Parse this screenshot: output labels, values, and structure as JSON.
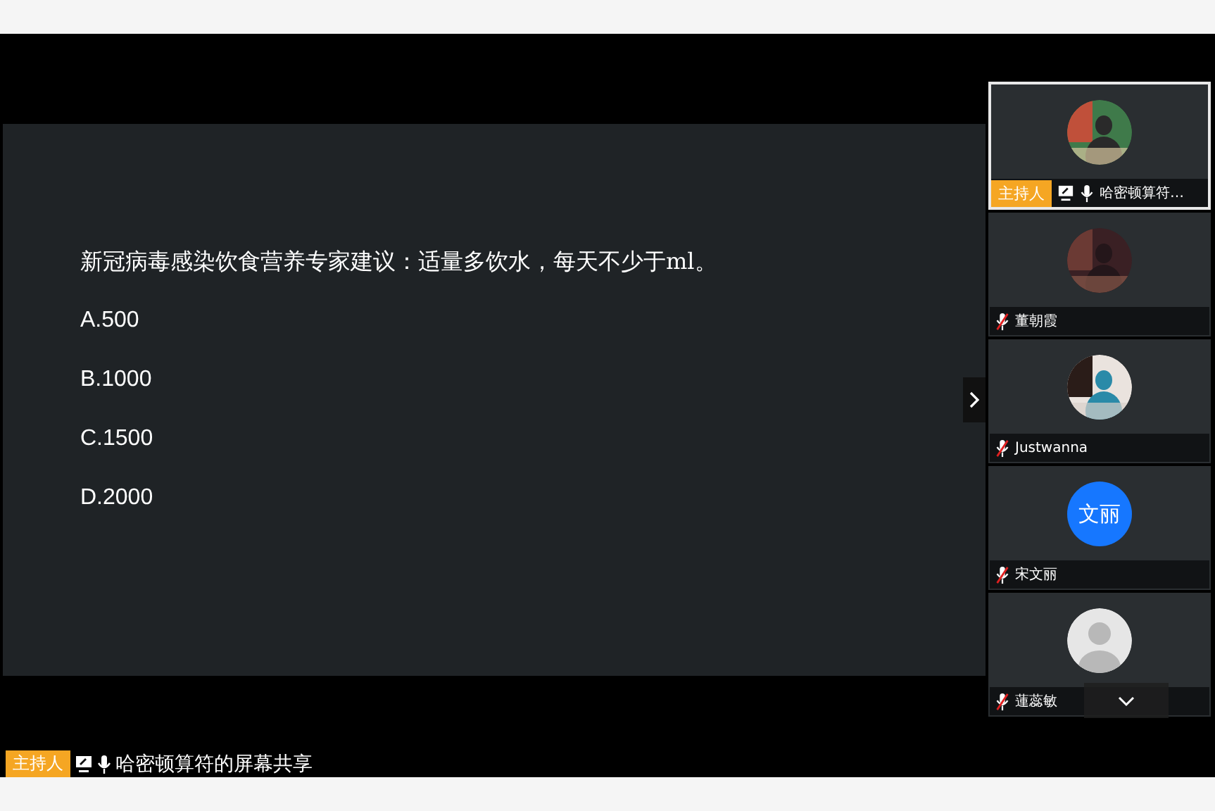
{
  "slide": {
    "question": "新冠病毒感染饮食营养专家建议：适量多饮水，每天不少于ml。",
    "options": [
      "A.500",
      "B.1000",
      "C.1500",
      "D.2000"
    ]
  },
  "participants": [
    {
      "name": "哈密顿算符…",
      "host_badge": "主持人",
      "sharing": true,
      "muted": false,
      "selected": true
    },
    {
      "name": "董朝霞",
      "sharing": false,
      "muted": true,
      "selected": false
    },
    {
      "name": "Justwanna",
      "sharing": false,
      "muted": true,
      "selected": false
    },
    {
      "name": "宋文丽",
      "sharing": false,
      "muted": true,
      "selected": false,
      "avatar": {
        "kind": "initials",
        "text": "文丽"
      }
    },
    {
      "name": "蓮蕊敏",
      "sharing": false,
      "muted": true,
      "selected": false,
      "avatar": {
        "kind": "default"
      }
    }
  ],
  "share_bar": {
    "host_badge": "主持人",
    "sharing": true,
    "muted": false,
    "caption": "哈密顿算符的屏幕共享"
  }
}
